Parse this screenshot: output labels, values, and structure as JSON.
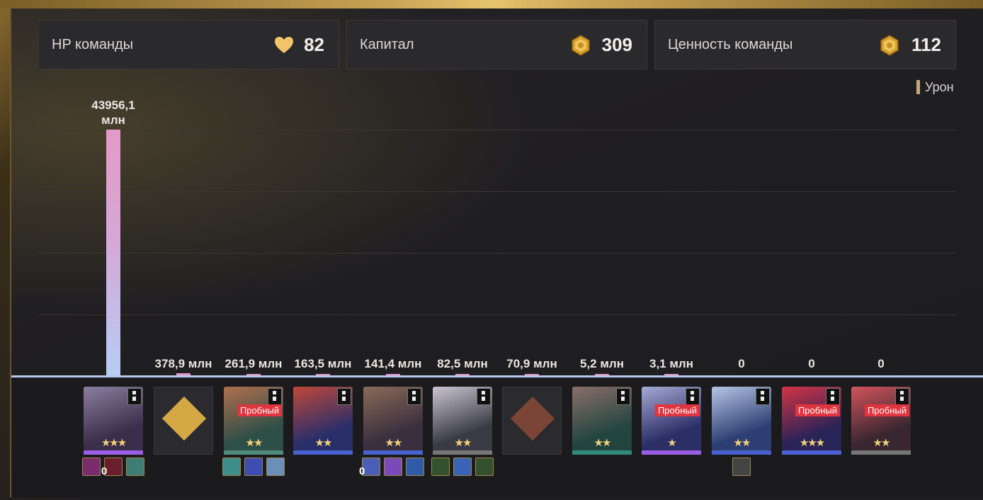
{
  "stats": {
    "team_hp": {
      "label": "HP команды",
      "value": "82",
      "icon": "heart-icon"
    },
    "capital": {
      "label": "Капитал",
      "value": "309",
      "icon": "gold-coin-icon"
    },
    "team_value": {
      "label": "Ценность команды",
      "value": "112",
      "icon": "gold-coin-icon"
    }
  },
  "colors": {
    "accent_gold": "#e3b04b",
    "bar_top": "#e39ac7",
    "bar_bottom": "#b7cdf5",
    "trial_badge": "#e0343f",
    "baseline": "#b9c8ef"
  },
  "chart_data": {
    "type": "bar",
    "series": [
      {
        "name": "Урон",
        "labels": [
          "43956,1 млн",
          "378,9 млн",
          "261,9 млн",
          "163,5 млн",
          "141,4 млн",
          "82,5 млн",
          "70,9 млн",
          "5,2 млн",
          "3,1 млн",
          "0",
          "0",
          "0"
        ],
        "values": [
          43956.1,
          378.9,
          261.9,
          163.5,
          141.4,
          82.5,
          70.9,
          5.2,
          3.1,
          0,
          0,
          0
        ]
      }
    ],
    "legend": "top-right",
    "grid": true
  },
  "label_top": {
    "line1": "43956,1",
    "line2": "млн"
  },
  "units": [
    {
      "kind": "character",
      "trial": false,
      "stars": "★★★",
      "rarity_color": "#9b5de5",
      "portrait": [
        "#3b2e4a",
        "#8a7fa0"
      ],
      "relics": [
        {
          "c": "#7a2d6d"
        },
        {
          "c": "#6b1f2c",
          "count": "0"
        },
        {
          "c": "#3f7d74"
        }
      ]
    },
    {
      "kind": "blank",
      "diamond_color": "#d4a845"
    },
    {
      "kind": "character",
      "trial": true,
      "trial_label": "Пробный",
      "stars": "★★",
      "rarity_color": "#4f8c7a",
      "portrait": [
        "#2e4f48",
        "#b06f4e"
      ],
      "relics": [
        {
          "c": "#3f8d8a"
        },
        {
          "c": "#3d4db0"
        },
        {
          "c": "#6b8fb8"
        }
      ]
    },
    {
      "kind": "character",
      "trial": false,
      "stars": "★★",
      "rarity_color": "#4a62d1",
      "portrait": [
        "#2a2f6a",
        "#c0473a"
      ],
      "relics": []
    },
    {
      "kind": "character",
      "trial": false,
      "stars": "★★",
      "rarity_color": "#4a62d1",
      "portrait": [
        "#3a2f3e",
        "#8a6a58"
      ],
      "relics": [
        {
          "c": "#4a5fb6",
          "count": "0"
        },
        {
          "c": "#7a4bb8"
        },
        {
          "c": "#2f5ca8"
        }
      ]
    },
    {
      "kind": "character",
      "trial": false,
      "stars": "★★",
      "rarity_color": "#777777",
      "portrait": [
        "#3a3a44",
        "#c9c6d2"
      ],
      "relics": [
        {
          "c": "#34512d"
        },
        {
          "c": "#3a63b8"
        },
        {
          "c": "#34512d"
        }
      ]
    },
    {
      "kind": "blank",
      "diamond_color": "#7a4536"
    },
    {
      "kind": "character",
      "trial": false,
      "stars": "★★",
      "rarity_color": "#2f8c7c",
      "portrait": [
        "#23453f",
        "#8a6e6a"
      ],
      "relics": []
    },
    {
      "kind": "character",
      "trial": true,
      "trial_label": "Пробный",
      "stars": "★",
      "rarity_color": "#9b5de5",
      "portrait": [
        "#2c2f66",
        "#a6a8d4"
      ],
      "relics": []
    },
    {
      "kind": "character",
      "trial": false,
      "stars": "★★",
      "rarity_color": "#4a62d1",
      "portrait": [
        "#2d3e72",
        "#b6c6e6"
      ],
      "relics": [
        {
          "c": "#444444"
        }
      ]
    },
    {
      "kind": "character",
      "trial": true,
      "trial_label": "Пробный",
      "stars": "★★★",
      "rarity_color": "#4a62d1",
      "portrait": [
        "#2a2357",
        "#d23445"
      ],
      "relics": []
    },
    {
      "kind": "character",
      "trial": true,
      "trial_label": "Пробный",
      "stars": "★★",
      "rarity_color": "#777777",
      "portrait": [
        "#3a2630",
        "#d2545c"
      ],
      "relics": []
    }
  ]
}
